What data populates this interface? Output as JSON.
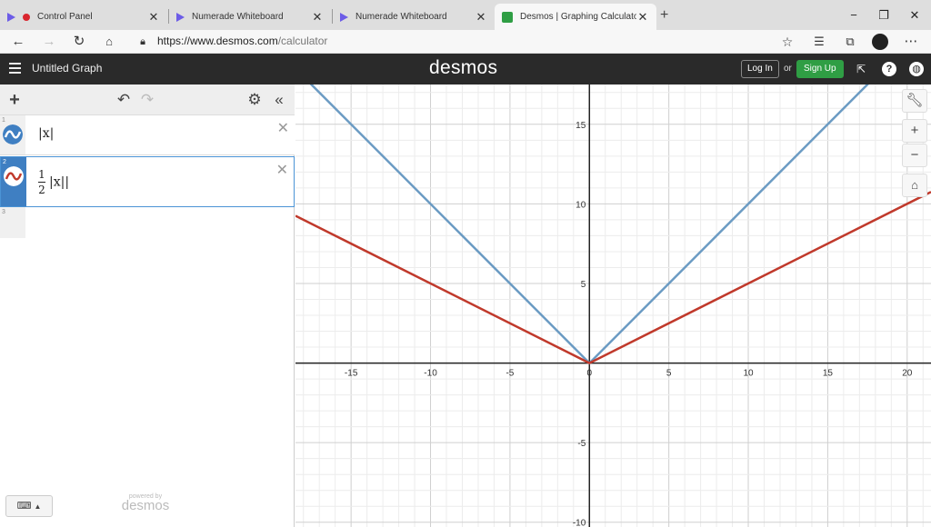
{
  "browser": {
    "tabs": [
      {
        "title": "Control Panel",
        "close": "✕"
      },
      {
        "title": "Numerade Whiteboard",
        "close": "✕"
      },
      {
        "title": "Numerade Whiteboard",
        "close": "✕"
      },
      {
        "title": "Desmos | Graphing Calculator",
        "close": "✕"
      }
    ],
    "new_tab": "+",
    "url_host": "https://www.desmos.com",
    "url_path": "/calculator",
    "window_buttons": {
      "minimize": "−",
      "restore": "❐",
      "close": "✕"
    }
  },
  "header": {
    "graph_title": "Untitled Graph",
    "logo": "desmos",
    "login_label": "Log In",
    "or_label": "or",
    "signup_label": "Sign Up",
    "help_label": "?"
  },
  "expressions": [
    {
      "index": "1",
      "latex": "|x|",
      "color": "#6b9bc3"
    },
    {
      "index": "2",
      "frac_num": "1",
      "frac_den": "2",
      "latex": "|x||",
      "color": "#c0392b"
    },
    {
      "index": "3"
    }
  ],
  "footer": {
    "powered_by": "powered by",
    "brand": "desmos",
    "keyboard_icon": "⌨"
  },
  "chart_data": {
    "type": "line",
    "title": "",
    "xlabel": "",
    "ylabel": "",
    "xlim": [
      -18.5,
      21.5
    ],
    "ylim": [
      -10.3,
      17.5
    ],
    "grid": true,
    "x_ticks": [
      -15,
      -10,
      -5,
      0,
      5,
      10,
      15,
      20
    ],
    "y_ticks": [
      -10,
      -5,
      5,
      10,
      15
    ],
    "series": [
      {
        "color": "#6b9bc3",
        "x": [
          -18.5,
          0,
          21.5
        ],
        "y": [
          18.5,
          0,
          21.5
        ]
      },
      {
        "color": "#c0392b",
        "x": [
          -18.5,
          0,
          21.5
        ],
        "y": [
          9.25,
          0,
          10.75
        ]
      }
    ]
  }
}
